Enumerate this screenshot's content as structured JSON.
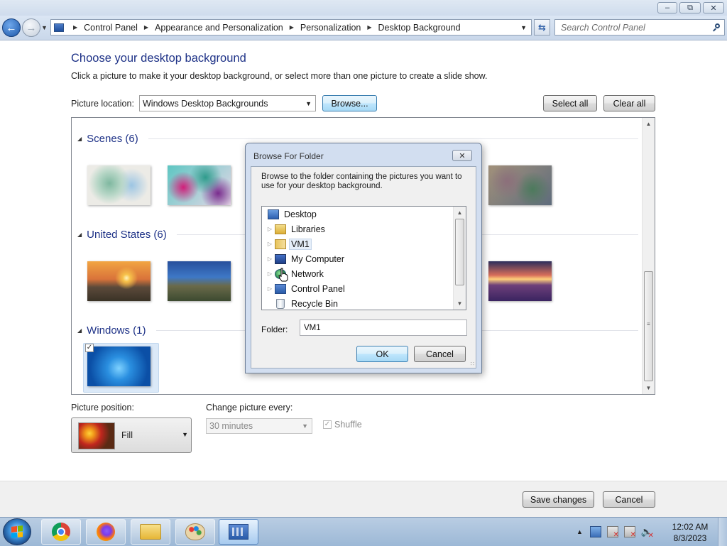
{
  "window": {
    "minimize_icon": "minimize-icon",
    "maximize_icon": "restore-icon",
    "close_icon": "close-icon"
  },
  "address_bar": {
    "breadcrumbs": [
      "Control Panel",
      "Appearance and Personalization",
      "Personalization",
      "Desktop Background"
    ],
    "search_placeholder": "Search Control Panel"
  },
  "main": {
    "heading": "Choose your desktop background",
    "subheading": "Click a picture to make it your desktop background, or select more than one picture to create a slide show.",
    "picture_location_label": "Picture location:",
    "picture_location_value": "Windows Desktop Backgrounds",
    "browse_label": "Browse...",
    "select_all_label": "Select all",
    "clear_all_label": "Clear all",
    "groups": [
      {
        "name": "Scenes (6)"
      },
      {
        "name": "United States (6)"
      },
      {
        "name": "Windows (1)"
      }
    ],
    "picture_position_label": "Picture position:",
    "picture_position_value": "Fill",
    "change_every_label": "Change picture every:",
    "change_every_value": "30 minutes",
    "shuffle_label": "Shuffle",
    "shuffle_checked": true,
    "save_label": "Save changes",
    "cancel_label": "Cancel"
  },
  "dialog": {
    "title": "Browse For Folder",
    "description": "Browse to the folder containing the pictures you want to use for your desktop background.",
    "tree": [
      {
        "label": "Desktop",
        "icon": "desktop-icon"
      },
      {
        "label": "Libraries",
        "icon": "libraries-icon"
      },
      {
        "label": "VM1",
        "icon": "user-folder-icon",
        "selected": true
      },
      {
        "label": "My Computer",
        "icon": "computer-icon"
      },
      {
        "label": "Network",
        "icon": "network-icon"
      },
      {
        "label": "Control Panel",
        "icon": "control-panel-icon"
      },
      {
        "label": "Recycle Bin",
        "icon": "recycle-bin-icon"
      }
    ],
    "folder_label": "Folder:",
    "folder_value": "VM1",
    "ok_label": "OK",
    "cancel_label": "Cancel"
  },
  "taskbar": {
    "apps": [
      "chrome-icon",
      "firefox-icon",
      "file-explorer-icon",
      "paint-icon",
      "control-panel-icon"
    ],
    "time": "12:02 AM",
    "date": "8/3/2023"
  }
}
